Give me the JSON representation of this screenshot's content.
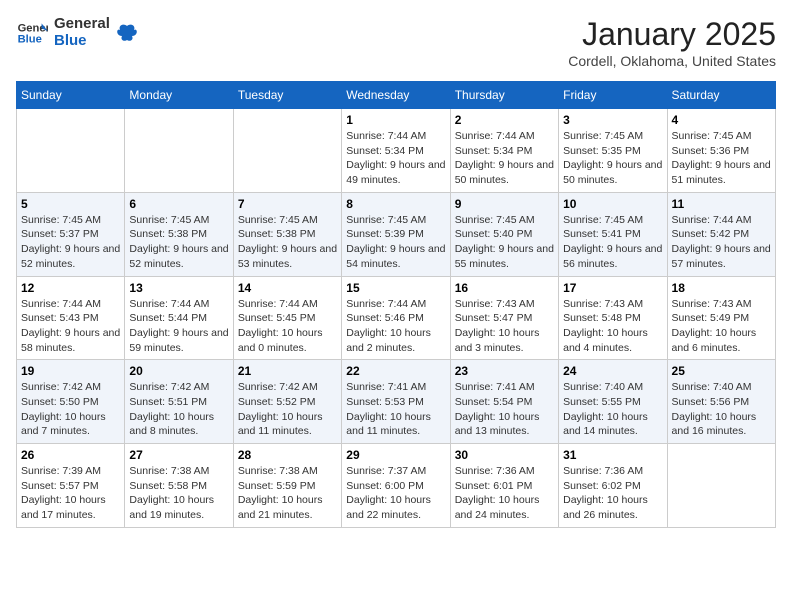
{
  "logo": {
    "general": "General",
    "blue": "Blue"
  },
  "header": {
    "title": "January 2025",
    "subtitle": "Cordell, Oklahoma, United States"
  },
  "weekdays": [
    "Sunday",
    "Monday",
    "Tuesday",
    "Wednesday",
    "Thursday",
    "Friday",
    "Saturday"
  ],
  "weeks": [
    [
      {
        "day": "",
        "info": ""
      },
      {
        "day": "",
        "info": ""
      },
      {
        "day": "",
        "info": ""
      },
      {
        "day": "1",
        "info": "Sunrise: 7:44 AM\nSunset: 5:34 PM\nDaylight: 9 hours and 49 minutes."
      },
      {
        "day": "2",
        "info": "Sunrise: 7:44 AM\nSunset: 5:34 PM\nDaylight: 9 hours and 50 minutes."
      },
      {
        "day": "3",
        "info": "Sunrise: 7:45 AM\nSunset: 5:35 PM\nDaylight: 9 hours and 50 minutes."
      },
      {
        "day": "4",
        "info": "Sunrise: 7:45 AM\nSunset: 5:36 PM\nDaylight: 9 hours and 51 minutes."
      }
    ],
    [
      {
        "day": "5",
        "info": "Sunrise: 7:45 AM\nSunset: 5:37 PM\nDaylight: 9 hours and 52 minutes."
      },
      {
        "day": "6",
        "info": "Sunrise: 7:45 AM\nSunset: 5:38 PM\nDaylight: 9 hours and 52 minutes."
      },
      {
        "day": "7",
        "info": "Sunrise: 7:45 AM\nSunset: 5:38 PM\nDaylight: 9 hours and 53 minutes."
      },
      {
        "day": "8",
        "info": "Sunrise: 7:45 AM\nSunset: 5:39 PM\nDaylight: 9 hours and 54 minutes."
      },
      {
        "day": "9",
        "info": "Sunrise: 7:45 AM\nSunset: 5:40 PM\nDaylight: 9 hours and 55 minutes."
      },
      {
        "day": "10",
        "info": "Sunrise: 7:45 AM\nSunset: 5:41 PM\nDaylight: 9 hours and 56 minutes."
      },
      {
        "day": "11",
        "info": "Sunrise: 7:44 AM\nSunset: 5:42 PM\nDaylight: 9 hours and 57 minutes."
      }
    ],
    [
      {
        "day": "12",
        "info": "Sunrise: 7:44 AM\nSunset: 5:43 PM\nDaylight: 9 hours and 58 minutes."
      },
      {
        "day": "13",
        "info": "Sunrise: 7:44 AM\nSunset: 5:44 PM\nDaylight: 9 hours and 59 minutes."
      },
      {
        "day": "14",
        "info": "Sunrise: 7:44 AM\nSunset: 5:45 PM\nDaylight: 10 hours and 0 minutes."
      },
      {
        "day": "15",
        "info": "Sunrise: 7:44 AM\nSunset: 5:46 PM\nDaylight: 10 hours and 2 minutes."
      },
      {
        "day": "16",
        "info": "Sunrise: 7:43 AM\nSunset: 5:47 PM\nDaylight: 10 hours and 3 minutes."
      },
      {
        "day": "17",
        "info": "Sunrise: 7:43 AM\nSunset: 5:48 PM\nDaylight: 10 hours and 4 minutes."
      },
      {
        "day": "18",
        "info": "Sunrise: 7:43 AM\nSunset: 5:49 PM\nDaylight: 10 hours and 6 minutes."
      }
    ],
    [
      {
        "day": "19",
        "info": "Sunrise: 7:42 AM\nSunset: 5:50 PM\nDaylight: 10 hours and 7 minutes."
      },
      {
        "day": "20",
        "info": "Sunrise: 7:42 AM\nSunset: 5:51 PM\nDaylight: 10 hours and 8 minutes."
      },
      {
        "day": "21",
        "info": "Sunrise: 7:42 AM\nSunset: 5:52 PM\nDaylight: 10 hours and 11 minutes."
      },
      {
        "day": "22",
        "info": "Sunrise: 7:41 AM\nSunset: 5:53 PM\nDaylight: 10 hours and 11 minutes."
      },
      {
        "day": "23",
        "info": "Sunrise: 7:41 AM\nSunset: 5:54 PM\nDaylight: 10 hours and 13 minutes."
      },
      {
        "day": "24",
        "info": "Sunrise: 7:40 AM\nSunset: 5:55 PM\nDaylight: 10 hours and 14 minutes."
      },
      {
        "day": "25",
        "info": "Sunrise: 7:40 AM\nSunset: 5:56 PM\nDaylight: 10 hours and 16 minutes."
      }
    ],
    [
      {
        "day": "26",
        "info": "Sunrise: 7:39 AM\nSunset: 5:57 PM\nDaylight: 10 hours and 17 minutes."
      },
      {
        "day": "27",
        "info": "Sunrise: 7:38 AM\nSunset: 5:58 PM\nDaylight: 10 hours and 19 minutes."
      },
      {
        "day": "28",
        "info": "Sunrise: 7:38 AM\nSunset: 5:59 PM\nDaylight: 10 hours and 21 minutes."
      },
      {
        "day": "29",
        "info": "Sunrise: 7:37 AM\nSunset: 6:00 PM\nDaylight: 10 hours and 22 minutes."
      },
      {
        "day": "30",
        "info": "Sunrise: 7:36 AM\nSunset: 6:01 PM\nDaylight: 10 hours and 24 minutes."
      },
      {
        "day": "31",
        "info": "Sunrise: 7:36 AM\nSunset: 6:02 PM\nDaylight: 10 hours and 26 minutes."
      },
      {
        "day": "",
        "info": ""
      }
    ]
  ]
}
